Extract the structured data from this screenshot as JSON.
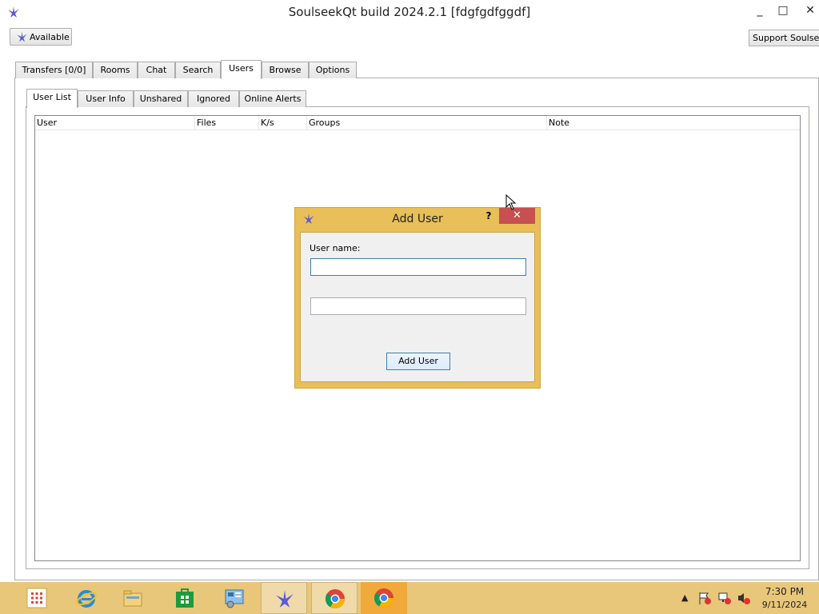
{
  "window": {
    "title": "SoulseekQt build 2024.2.1 [fdgfgdfggdf]",
    "minimize_glyph": "_",
    "maximize_glyph": "□",
    "close_glyph": "✕"
  },
  "toolbar": {
    "status_label": "Available",
    "support_label": "Support Soulseek"
  },
  "main_tabs": [
    {
      "label": "Transfers [0/0]"
    },
    {
      "label": "Rooms"
    },
    {
      "label": "Chat"
    },
    {
      "label": "Search"
    },
    {
      "label": "Users"
    },
    {
      "label": "Browse"
    },
    {
      "label": "Options"
    }
  ],
  "user_tabs": [
    {
      "label": "User List"
    },
    {
      "label": "User Info"
    },
    {
      "label": "Unshared"
    },
    {
      "label": "Ignored"
    },
    {
      "label": "Online Alerts"
    }
  ],
  "table": {
    "columns": [
      "User",
      "Files",
      "K/s",
      "Groups",
      "Note"
    ]
  },
  "dialog": {
    "title": "Add User",
    "help_glyph": "?",
    "close_glyph": "✕",
    "username_label": "User name:",
    "username_value": "",
    "second_value": "",
    "add_button": "Add User"
  },
  "taskbar": {
    "time": "7:30 PM",
    "date": "9/11/2024"
  },
  "colors": {
    "taskbar": "#e8c77b",
    "dialog_frame": "#e8bf58",
    "close_red": "#c75050",
    "accent_blue": "#3c7fb1"
  }
}
